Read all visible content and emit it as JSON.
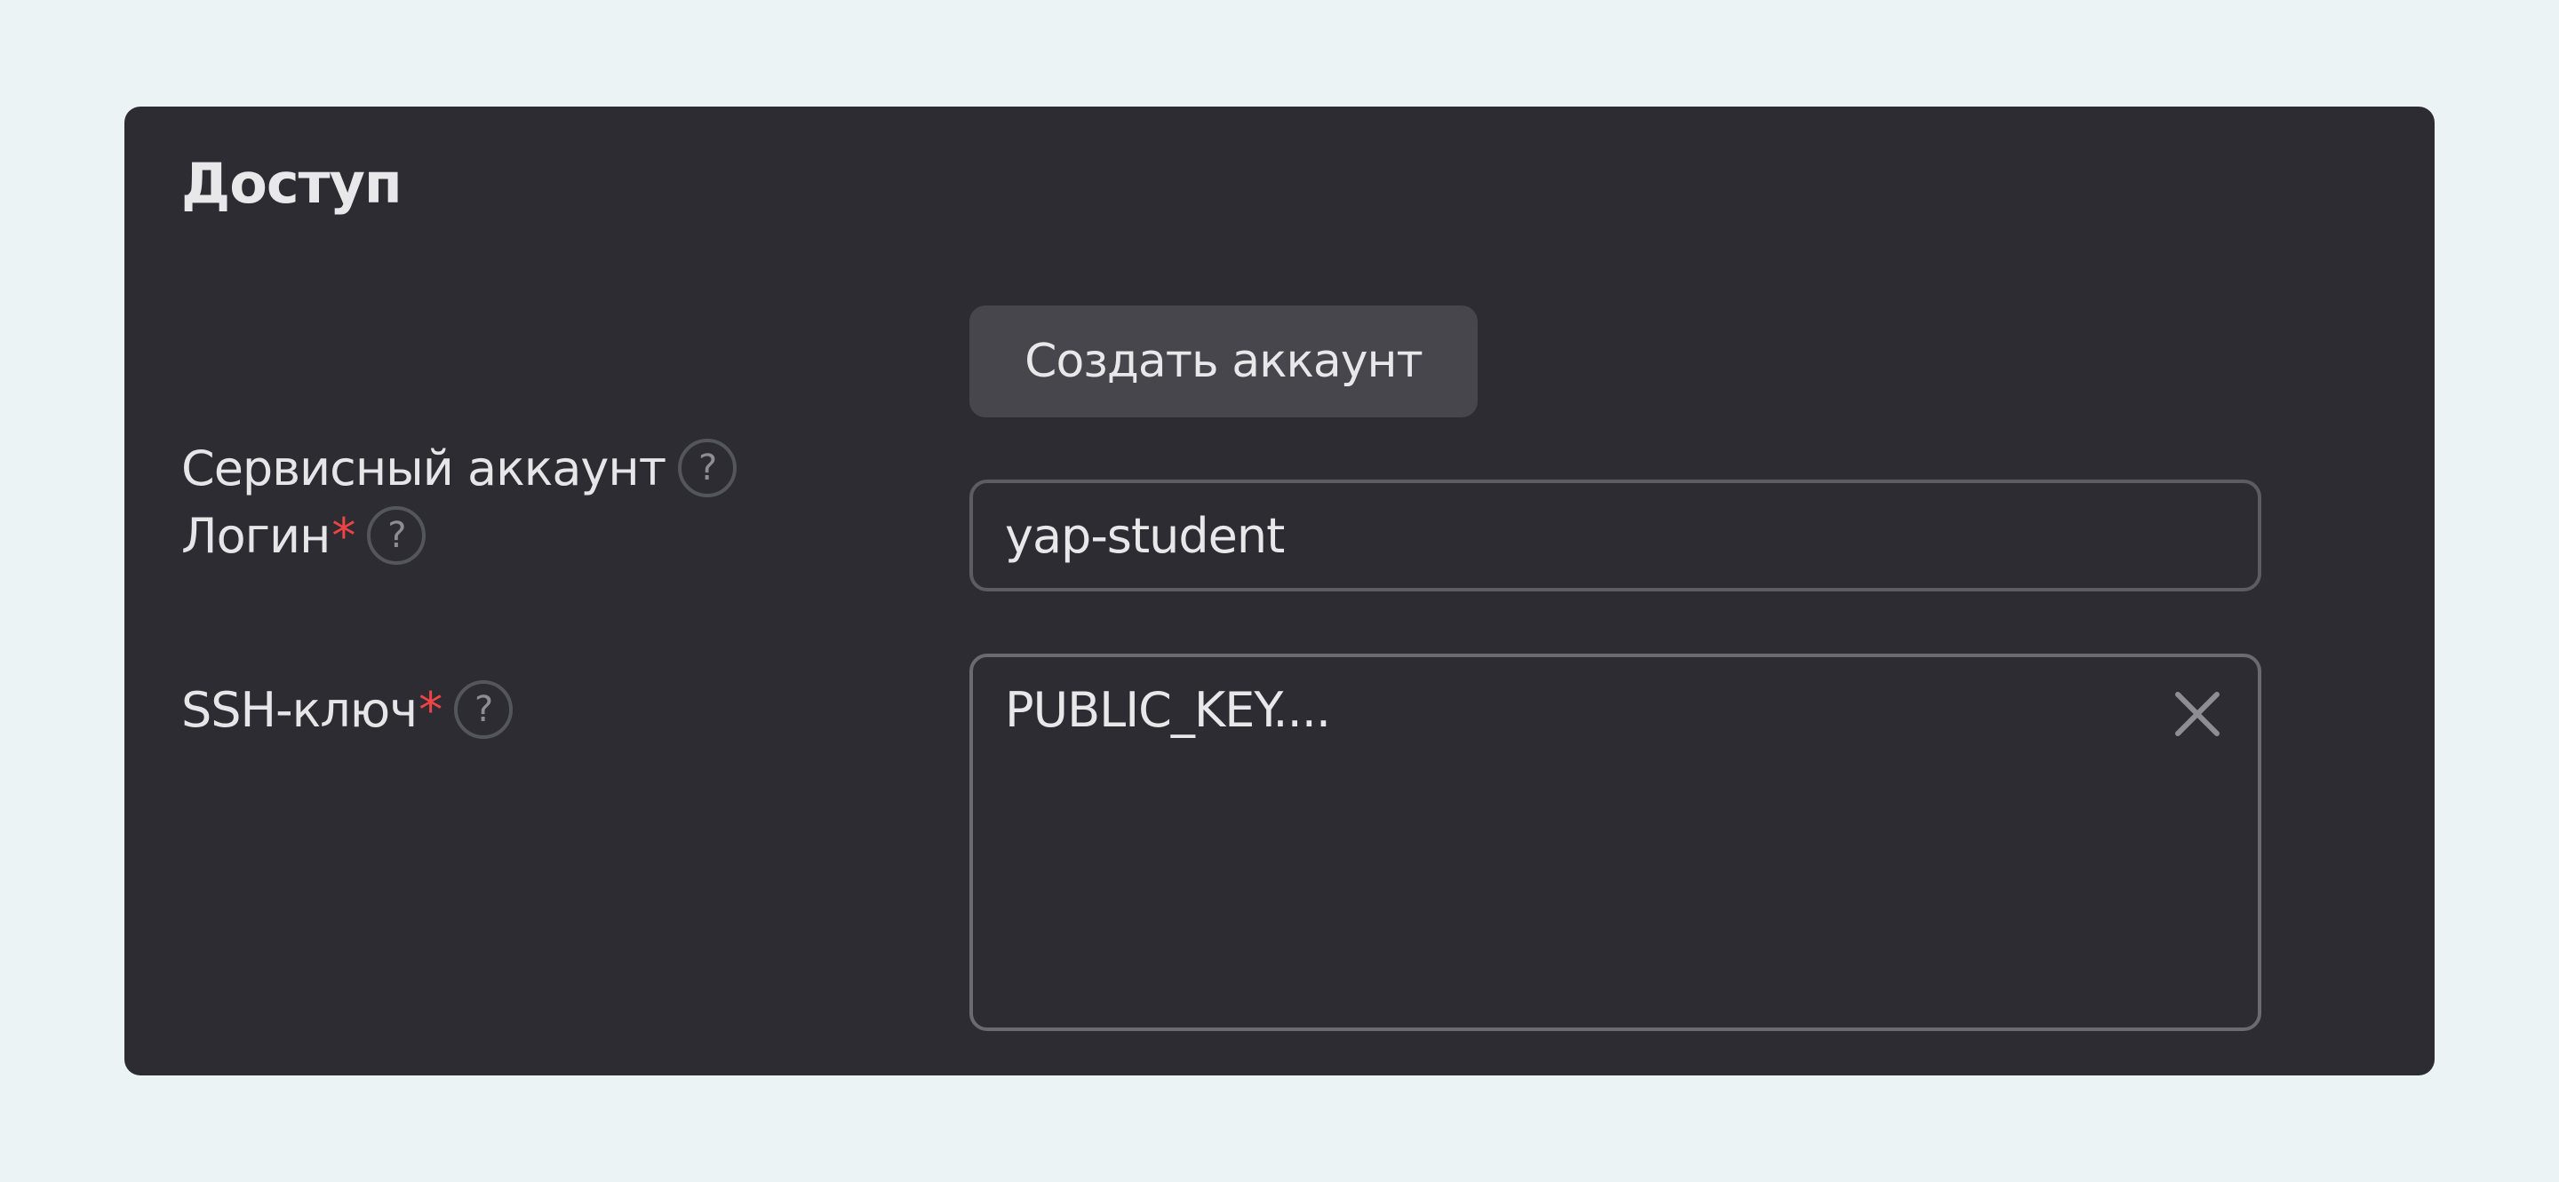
{
  "section": {
    "title": "Доступ"
  },
  "service_account": {
    "label": "Сервисный аккаунт",
    "help": "?",
    "button_label": "Создать аккаунт"
  },
  "login": {
    "label": "Логин",
    "required_mark": "*",
    "help": "?",
    "value": "yap-student"
  },
  "ssh_key": {
    "label": "SSH-ключ",
    "required_mark": "*",
    "help": "?",
    "value": "PUBLIC_KEY...."
  },
  "icons": {
    "help": "question-circle-icon",
    "clear": "close-icon"
  },
  "colors": {
    "page_background": "#ebf3f5",
    "panel_background": "#2d2c33",
    "required_mark": "#ef4444",
    "button_background": "#47464d",
    "text": "#e8e8ea"
  }
}
